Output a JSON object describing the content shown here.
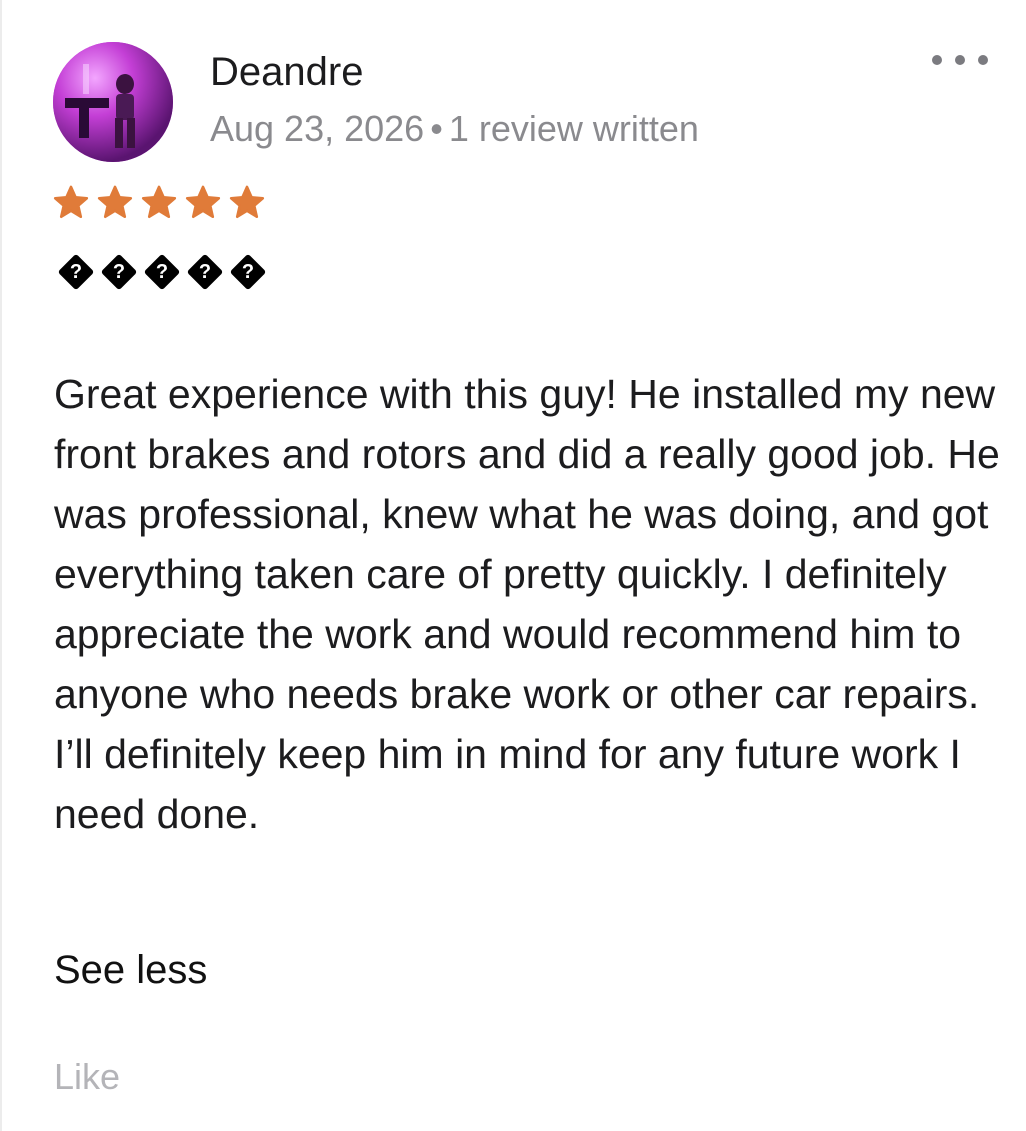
{
  "review": {
    "author": "Deandre",
    "date": "Aug 23, 2026",
    "separator": "•",
    "review_count": "1 review written",
    "rating": 5,
    "rating_max": 5,
    "star_color": "#E07B39",
    "glyphs": [
      "?",
      "?",
      "?",
      "?",
      "?"
    ],
    "body": "Great experience with this guy! He installed my new front brakes and rotors and did a really good job. He was professional, knew what he was doing, and got everything taken care of pretty quickly. I definitely appreciate the work and would recommend him to anyone who needs brake work or other car repairs. I’ll definitely keep him in mind for any future work I need done.",
    "see_less_label": "See less",
    "like_label": "Like",
    "more_icon": "more-horizontal-icon"
  }
}
